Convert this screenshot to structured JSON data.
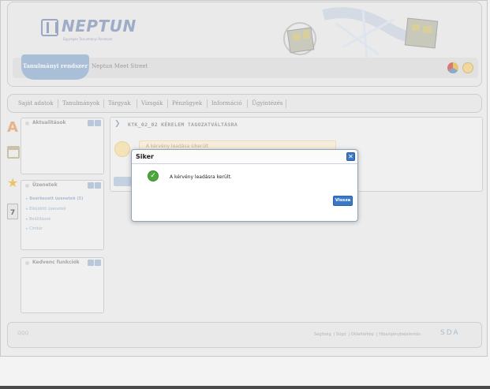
{
  "header": {
    "logo_text": "NEPTUN",
    "logo_subtitle": "Egységes Tanulmányi Rendszer",
    "system_tab": "Tanulmányi rendszer",
    "street": "Neptun Meet Street"
  },
  "nav": {
    "items": [
      "Saját adatok",
      "Tanulmányok",
      "Tárgyak",
      "Vizsgák",
      "Pénzügyek",
      "Információ",
      "Ügyintézés"
    ]
  },
  "sidebar": {
    "boxes": [
      {
        "title": "Aktualitások",
        "items": []
      },
      {
        "title": "Üzenetek",
        "items": [
          "Beérkezett üzenetek (5)",
          "Elküldött üzenetek",
          "Beállítások",
          "Címtár"
        ]
      },
      {
        "title": "Kedvenc funkciók",
        "items": []
      }
    ]
  },
  "main": {
    "title": "KTK_02_02 KÉRELEM TAGOZATVÁLTÁSRA",
    "note": "A kérvény leadása sikerült"
  },
  "dialog": {
    "title": "Siker",
    "message": "A kérvény leadásra került.",
    "button": "Vissza",
    "close_glyph": "✕",
    "success_glyph": "✓"
  },
  "footer": {
    "left": "QQQ",
    "links": [
      "Segítség",
      "Súgó",
      "Oldaltérkép",
      "Hiba/igénybejelentés"
    ],
    "logo": "SDA"
  },
  "colors": {
    "accent": "#3a78c9",
    "success": "#4ea73a",
    "tab": "#a9bfd7"
  }
}
